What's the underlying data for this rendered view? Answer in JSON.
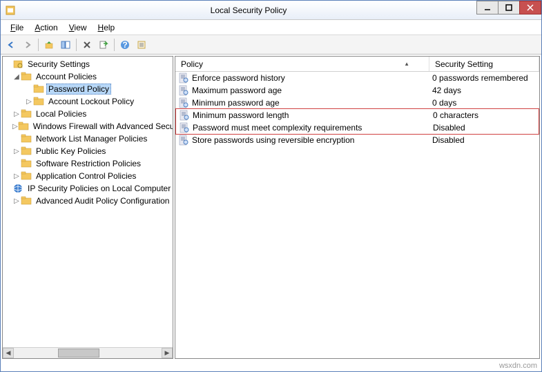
{
  "window": {
    "title": "Local Security Policy"
  },
  "menubar": {
    "file": "File",
    "action": "Action",
    "view": "View",
    "help": "Help"
  },
  "tree": {
    "root": "Security Settings",
    "account_policies": "Account Policies",
    "password_policy": "Password Policy",
    "account_lockout_policy": "Account Lockout Policy",
    "local_policies": "Local Policies",
    "windows_firewall": "Windows Firewall with Advanced Security",
    "network_list": "Network List Manager Policies",
    "public_key": "Public Key Policies",
    "software_restriction": "Software Restriction Policies",
    "application_control": "Application Control Policies",
    "ip_security": "IP Security Policies on Local Computer",
    "advanced_audit": "Advanced Audit Policy Configuration"
  },
  "list": {
    "columns": {
      "policy": "Policy",
      "setting": "Security Setting"
    },
    "rows": [
      {
        "policy": "Enforce password history",
        "setting": "0 passwords remembered",
        "highlighted": false
      },
      {
        "policy": "Maximum password age",
        "setting": "42 days",
        "highlighted": false
      },
      {
        "policy": "Minimum password age",
        "setting": "0 days",
        "highlighted": false
      },
      {
        "policy": "Minimum password length",
        "setting": "0 characters",
        "highlighted": true
      },
      {
        "policy": "Password must meet complexity requirements",
        "setting": "Disabled",
        "highlighted": true
      },
      {
        "policy": "Store passwords using reversible encryption",
        "setting": "Disabled",
        "highlighted": false
      }
    ]
  },
  "watermark": "wsxdn.com"
}
